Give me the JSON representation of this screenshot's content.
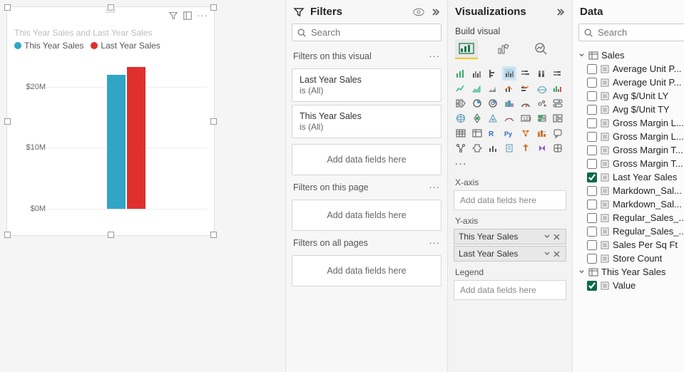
{
  "chart_data": {
    "type": "bar",
    "title": "This Year Sales and Last Year Sales",
    "categories": [
      ""
    ],
    "series": [
      {
        "name": "This Year Sales",
        "values": [
          22000000
        ],
        "color": "#30a5c6"
      },
      {
        "name": "Last Year Sales",
        "values": [
          23200000
        ],
        "color": "#e0302d"
      }
    ],
    "y_ticks": [
      "$0M",
      "$10M",
      "$20M"
    ],
    "ylim": [
      0,
      25000000
    ],
    "xlabel": "",
    "ylabel": ""
  },
  "filters": {
    "title": "Filters",
    "search_placeholder": "Search",
    "sections": {
      "visual": "Filters on this visual",
      "page": "Filters on this page",
      "all": "Filters on all pages"
    },
    "visual_filters": [
      {
        "name": "Last Year Sales",
        "condition": "is (All)"
      },
      {
        "name": "This Year Sales",
        "condition": "is (All)"
      }
    ],
    "drop_text": "Add data fields here"
  },
  "viz": {
    "title": "Visualizations",
    "subtitle": "Build visual",
    "wells": {
      "xaxis": {
        "label": "X-axis",
        "placeholder": "Add data fields here",
        "pills": []
      },
      "yaxis": {
        "label": "Y-axis",
        "placeholder": "Add data fields here",
        "pills": [
          "This Year Sales",
          "Last Year Sales"
        ]
      },
      "legend": {
        "label": "Legend",
        "placeholder": "Add data fields here",
        "pills": []
      }
    },
    "more_glyph": "···"
  },
  "data": {
    "title": "Data",
    "search_placeholder": "Search",
    "tables": [
      {
        "name": "Sales",
        "expanded": true,
        "columns": [
          {
            "name": "Average Unit P...",
            "checked": false
          },
          {
            "name": "Average Unit P...",
            "checked": false
          },
          {
            "name": "Avg $/Unit LY",
            "checked": false
          },
          {
            "name": "Avg $/Unit TY",
            "checked": false
          },
          {
            "name": "Gross Margin L...",
            "checked": false
          },
          {
            "name": "Gross Margin L...",
            "checked": false
          },
          {
            "name": "Gross Margin T...",
            "checked": false
          },
          {
            "name": "Gross Margin T...",
            "checked": false
          },
          {
            "name": "Last Year Sales",
            "checked": true
          },
          {
            "name": "Markdown_Sal...",
            "checked": false
          },
          {
            "name": "Markdown_Sal...",
            "checked": false
          },
          {
            "name": "Regular_Sales_...",
            "checked": false
          },
          {
            "name": "Regular_Sales_...",
            "checked": false
          },
          {
            "name": "Sales Per Sq Ft",
            "checked": false
          },
          {
            "name": "Store Count",
            "checked": false
          }
        ]
      },
      {
        "name": "This Year Sales",
        "expanded": true,
        "columns": [
          {
            "name": "Value",
            "checked": true
          }
        ]
      }
    ]
  }
}
